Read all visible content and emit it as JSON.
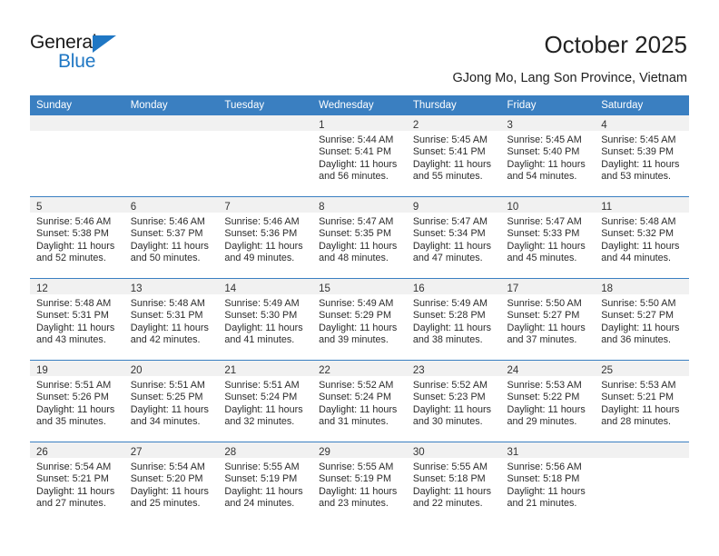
{
  "brand": {
    "name_top": "General",
    "name_bottom": "Blue",
    "accent_color": "#1f77c4"
  },
  "header": {
    "title": "October 2025",
    "subtitle": "GJong Mo, Lang Son Province, Vietnam"
  },
  "theme": {
    "header_row_bg": "#3a7fc1",
    "daynum_bg": "#f1f1f1",
    "grid_line": "#3a7fc1"
  },
  "weekdays": [
    "Sunday",
    "Monday",
    "Tuesday",
    "Wednesday",
    "Thursday",
    "Friday",
    "Saturday"
  ],
  "weeks": [
    [
      {
        "day": "",
        "lines": []
      },
      {
        "day": "",
        "lines": []
      },
      {
        "day": "",
        "lines": []
      },
      {
        "day": "1",
        "lines": [
          "Sunrise: 5:44 AM",
          "Sunset: 5:41 PM",
          "Daylight: 11 hours and 56 minutes."
        ]
      },
      {
        "day": "2",
        "lines": [
          "Sunrise: 5:45 AM",
          "Sunset: 5:41 PM",
          "Daylight: 11 hours and 55 minutes."
        ]
      },
      {
        "day": "3",
        "lines": [
          "Sunrise: 5:45 AM",
          "Sunset: 5:40 PM",
          "Daylight: 11 hours and 54 minutes."
        ]
      },
      {
        "day": "4",
        "lines": [
          "Sunrise: 5:45 AM",
          "Sunset: 5:39 PM",
          "Daylight: 11 hours and 53 minutes."
        ]
      }
    ],
    [
      {
        "day": "5",
        "lines": [
          "Sunrise: 5:46 AM",
          "Sunset: 5:38 PM",
          "Daylight: 11 hours and 52 minutes."
        ]
      },
      {
        "day": "6",
        "lines": [
          "Sunrise: 5:46 AM",
          "Sunset: 5:37 PM",
          "Daylight: 11 hours and 50 minutes."
        ]
      },
      {
        "day": "7",
        "lines": [
          "Sunrise: 5:46 AM",
          "Sunset: 5:36 PM",
          "Daylight: 11 hours and 49 minutes."
        ]
      },
      {
        "day": "8",
        "lines": [
          "Sunrise: 5:47 AM",
          "Sunset: 5:35 PM",
          "Daylight: 11 hours and 48 minutes."
        ]
      },
      {
        "day": "9",
        "lines": [
          "Sunrise: 5:47 AM",
          "Sunset: 5:34 PM",
          "Daylight: 11 hours and 47 minutes."
        ]
      },
      {
        "day": "10",
        "lines": [
          "Sunrise: 5:47 AM",
          "Sunset: 5:33 PM",
          "Daylight: 11 hours and 45 minutes."
        ]
      },
      {
        "day": "11",
        "lines": [
          "Sunrise: 5:48 AM",
          "Sunset: 5:32 PM",
          "Daylight: 11 hours and 44 minutes."
        ]
      }
    ],
    [
      {
        "day": "12",
        "lines": [
          "Sunrise: 5:48 AM",
          "Sunset: 5:31 PM",
          "Daylight: 11 hours and 43 minutes."
        ]
      },
      {
        "day": "13",
        "lines": [
          "Sunrise: 5:48 AM",
          "Sunset: 5:31 PM",
          "Daylight: 11 hours and 42 minutes."
        ]
      },
      {
        "day": "14",
        "lines": [
          "Sunrise: 5:49 AM",
          "Sunset: 5:30 PM",
          "Daylight: 11 hours and 41 minutes."
        ]
      },
      {
        "day": "15",
        "lines": [
          "Sunrise: 5:49 AM",
          "Sunset: 5:29 PM",
          "Daylight: 11 hours and 39 minutes."
        ]
      },
      {
        "day": "16",
        "lines": [
          "Sunrise: 5:49 AM",
          "Sunset: 5:28 PM",
          "Daylight: 11 hours and 38 minutes."
        ]
      },
      {
        "day": "17",
        "lines": [
          "Sunrise: 5:50 AM",
          "Sunset: 5:27 PM",
          "Daylight: 11 hours and 37 minutes."
        ]
      },
      {
        "day": "18",
        "lines": [
          "Sunrise: 5:50 AM",
          "Sunset: 5:27 PM",
          "Daylight: 11 hours and 36 minutes."
        ]
      }
    ],
    [
      {
        "day": "19",
        "lines": [
          "Sunrise: 5:51 AM",
          "Sunset: 5:26 PM",
          "Daylight: 11 hours and 35 minutes."
        ]
      },
      {
        "day": "20",
        "lines": [
          "Sunrise: 5:51 AM",
          "Sunset: 5:25 PM",
          "Daylight: 11 hours and 34 minutes."
        ]
      },
      {
        "day": "21",
        "lines": [
          "Sunrise: 5:51 AM",
          "Sunset: 5:24 PM",
          "Daylight: 11 hours and 32 minutes."
        ]
      },
      {
        "day": "22",
        "lines": [
          "Sunrise: 5:52 AM",
          "Sunset: 5:24 PM",
          "Daylight: 11 hours and 31 minutes."
        ]
      },
      {
        "day": "23",
        "lines": [
          "Sunrise: 5:52 AM",
          "Sunset: 5:23 PM",
          "Daylight: 11 hours and 30 minutes."
        ]
      },
      {
        "day": "24",
        "lines": [
          "Sunrise: 5:53 AM",
          "Sunset: 5:22 PM",
          "Daylight: 11 hours and 29 minutes."
        ]
      },
      {
        "day": "25",
        "lines": [
          "Sunrise: 5:53 AM",
          "Sunset: 5:21 PM",
          "Daylight: 11 hours and 28 minutes."
        ]
      }
    ],
    [
      {
        "day": "26",
        "lines": [
          "Sunrise: 5:54 AM",
          "Sunset: 5:21 PM",
          "Daylight: 11 hours and 27 minutes."
        ]
      },
      {
        "day": "27",
        "lines": [
          "Sunrise: 5:54 AM",
          "Sunset: 5:20 PM",
          "Daylight: 11 hours and 25 minutes."
        ]
      },
      {
        "day": "28",
        "lines": [
          "Sunrise: 5:55 AM",
          "Sunset: 5:19 PM",
          "Daylight: 11 hours and 24 minutes."
        ]
      },
      {
        "day": "29",
        "lines": [
          "Sunrise: 5:55 AM",
          "Sunset: 5:19 PM",
          "Daylight: 11 hours and 23 minutes."
        ]
      },
      {
        "day": "30",
        "lines": [
          "Sunrise: 5:55 AM",
          "Sunset: 5:18 PM",
          "Daylight: 11 hours and 22 minutes."
        ]
      },
      {
        "day": "31",
        "lines": [
          "Sunrise: 5:56 AM",
          "Sunset: 5:18 PM",
          "Daylight: 11 hours and 21 minutes."
        ]
      },
      {
        "day": "",
        "lines": []
      }
    ]
  ]
}
